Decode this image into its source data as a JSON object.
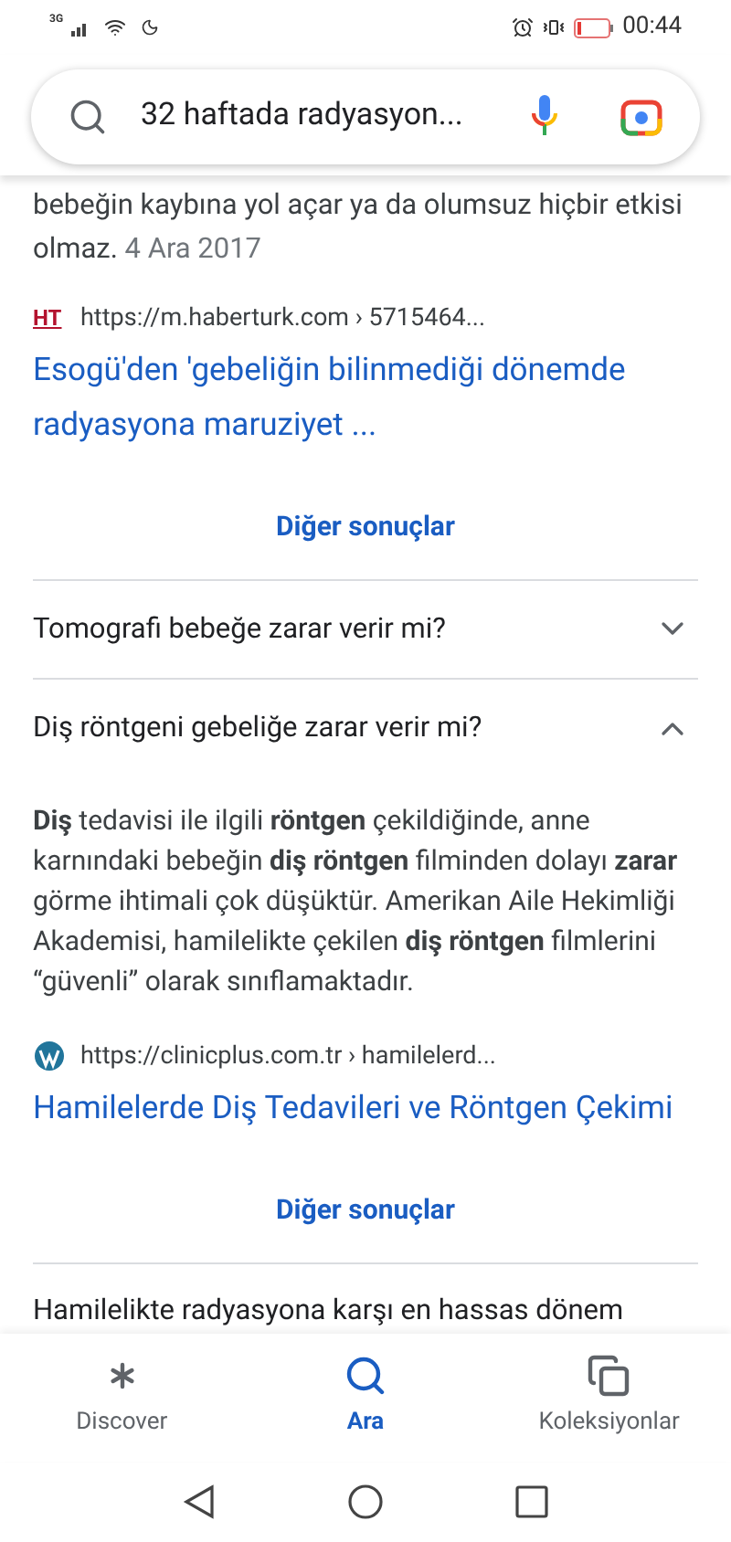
{
  "status_bar": {
    "network": "3G",
    "time": "00:44"
  },
  "search": {
    "value": "32 haftada radyasyon..."
  },
  "results": [
    {
      "kind": "snippet",
      "text": "bebeğin kaybına yol açar ya da olumsuz hiçbir etkisi olmaz.",
      "date": "4 Ara 2017"
    },
    {
      "kind": "result",
      "favicon": {
        "kind": "letters",
        "text": "HT"
      },
      "url": "https://m.haberturk.com › 5715464...",
      "title": "Esogü'den 'gebeliğin bilinmediği dönemde radyasyona maruziyet ..."
    },
    {
      "kind": "more",
      "label": "Diğer sonuçlar"
    },
    {
      "kind": "question",
      "text": "Tomografi bebeğe zarar verir mi?",
      "expanded": false
    },
    {
      "kind": "question",
      "text": "Diş röntgeni gebeliğe zarar verir mi?",
      "expanded": true
    },
    {
      "kind": "answer",
      "text": "**Diş** tedavisi ile ilgili **röntgen** çekildiğinde, anne karnındaki bebeğin **diş röntgen** filminden dolayı **zarar** görme ihtimali çok düşüktür. Amerikan Aile Hekimliği Akademisi, hamilelikte çekilen **diş röntgen** filmlerini “güvenli” olarak sınıflamaktadır."
    },
    {
      "kind": "result",
      "favicon": {
        "kind": "wordpress"
      },
      "url": "https://clinicplus.com.tr › hamilelerd...",
      "title": "Hamilelerde Diş Tedavileri ve Röntgen Çekimi"
    },
    {
      "kind": "more",
      "label": "Diğer sonuçlar"
    },
    {
      "kind": "question",
      "text": "Hamilelikte radyasyona karşı en hassas dönem"
    }
  ],
  "bottom_nav": [
    {
      "label": "Discover",
      "selected": false
    },
    {
      "label": "Ara",
      "selected": true
    },
    {
      "label": "Koleksiyonlar",
      "selected": false
    }
  ]
}
